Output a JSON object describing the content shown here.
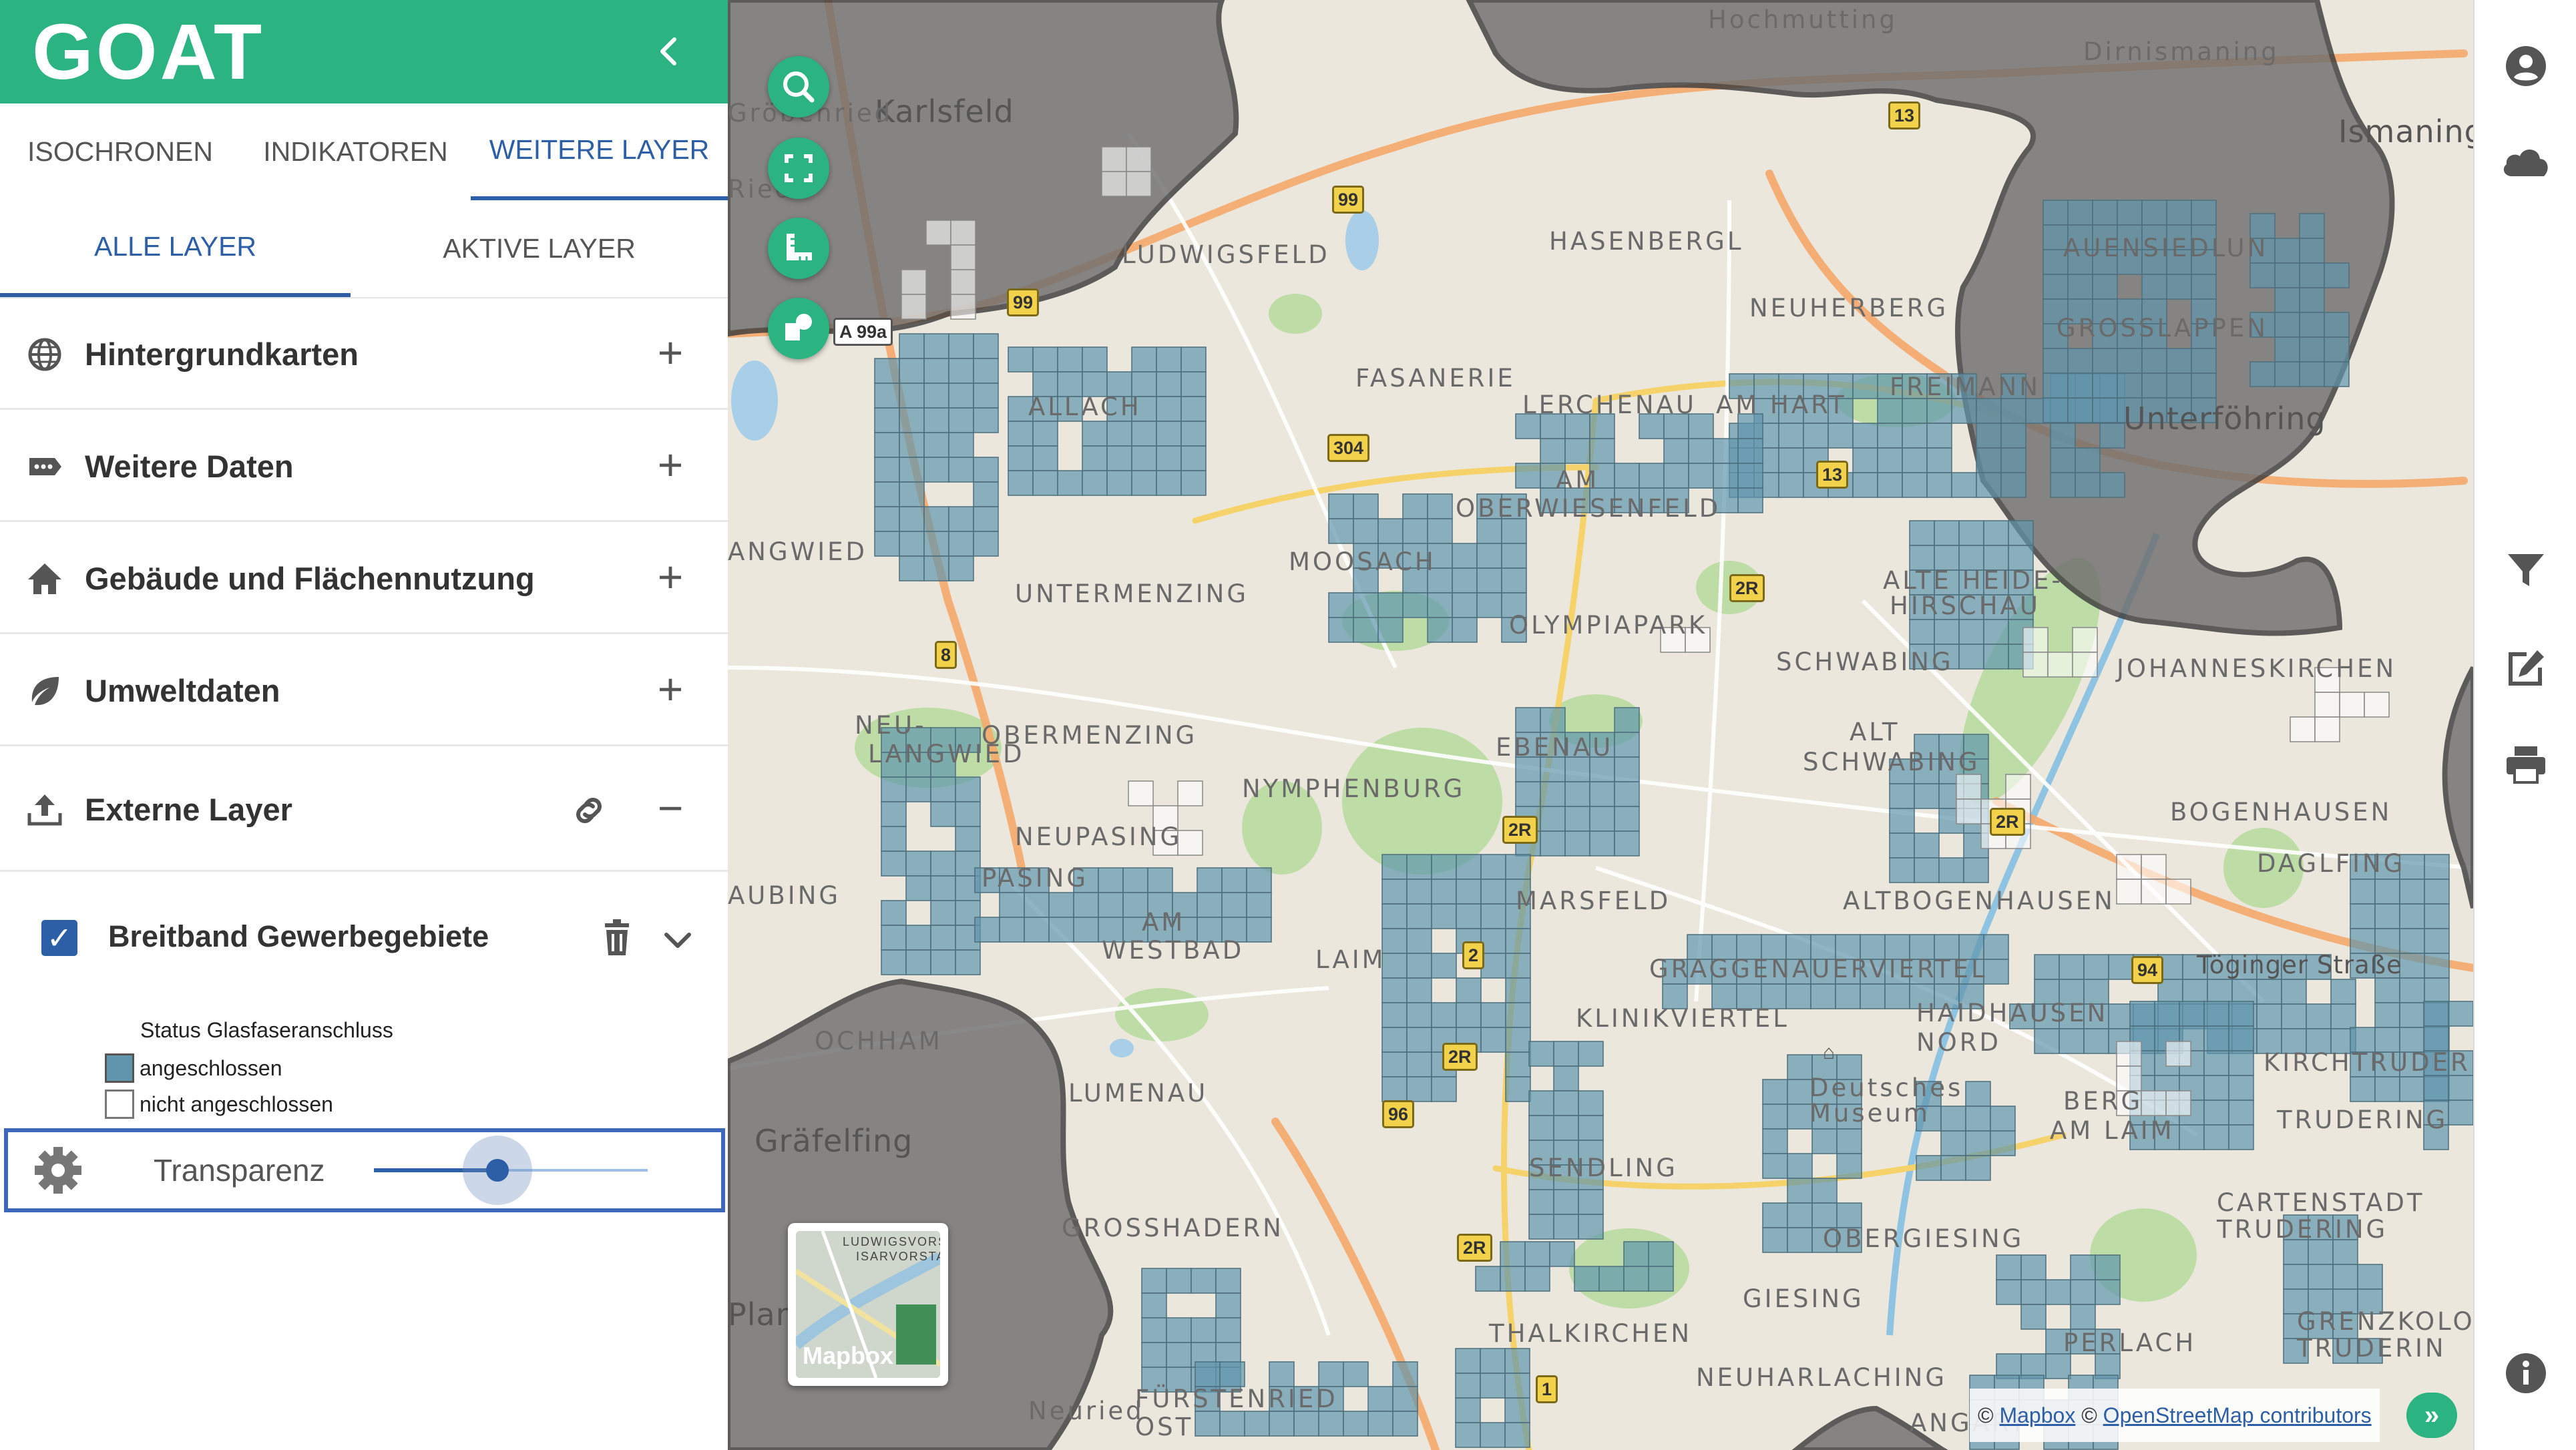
{
  "app": {
    "logo_text": "GOAT",
    "brand_color": "#2bb381",
    "accent_color": "#2d5fa7"
  },
  "main_tabs": [
    "ISOCHRONEN",
    "INDIKATOREN",
    "WEITERE LAYER"
  ],
  "sub_tabs": [
    "ALLE LAYER",
    "AKTIVE LAYER"
  ],
  "categories": [
    {
      "label": "Hintergrundkarten",
      "icon": "globe-icon"
    },
    {
      "label": "Weitere Daten",
      "icon": "data-tag-icon"
    },
    {
      "label": "Gebäude und Flächennutzung",
      "icon": "home-icon"
    },
    {
      "label": "Umweltdaten",
      "icon": "leaf-icon"
    },
    {
      "label": "Externe Layer",
      "icon": "upload-icon"
    }
  ],
  "active_layer": {
    "name": "Breitband Gewerbegebiete",
    "checked": true
  },
  "legend": {
    "title": "Status Glasfaseranschluss",
    "items": [
      {
        "label": "angeschlossen",
        "color": "#5f96ae"
      },
      {
        "label": "nicht angeschlossen",
        "color": "#ffffff"
      }
    ]
  },
  "transparency": {
    "label": "Transparenz",
    "value": 0.45
  },
  "map": {
    "basemap_label": "Mapbox",
    "basemap_thumb_text": [
      "LUDWIGSVORS",
      "ISARVORSTA"
    ],
    "attribution": {
      "mapbox": "Mapbox",
      "osm": "OpenStreetMap contributors"
    },
    "places": [
      "Karlsfeld",
      "Hochmutting",
      "Dirnismaning",
      "Ismaning",
      "LUDWIGSFELD",
      "HASENBERGL",
      "AUENSIEDLUN",
      "NEUHERBERG",
      "GROSSLAPPEN",
      "FASANERIE",
      "FREIMANN",
      "Unterföhring",
      "ALLACH",
      "LERCHENAU",
      "AM HART",
      "AM",
      "OBERWIESENFELD",
      "ANGWIED",
      "UNTERMENZING",
      "MOOSACH",
      "ALTE HEIDE-",
      "HIRSCHAU",
      "OLYMPIAPARK",
      "SCHWABING",
      "JOHANNESKIRCHEN",
      "NEU-",
      "LANGWIED",
      "OBERMENZING",
      "ALT",
      "SCHWABING",
      "EBENAU",
      "NYMPHENBURG",
      "BOGENHAUSEN",
      "NEUPASING",
      "PASING",
      "DAGLFING",
      "AUBING",
      "AM",
      "WESTBAD",
      "LAIM",
      "MARSFELD",
      "ALTBOGENHAUSEN",
      "GRAGGENAUERVIERTEL",
      "OCHHAM",
      "KLINIKVIERTEL",
      "HAIDHAUSEN",
      "NORD",
      "KIRCHTRUDERIN",
      "Deutsches",
      "Museum",
      "BERG",
      "AM LAIM",
      "TRUDERING",
      "Gräfelfing",
      "LUMENAU",
      "SENDLING",
      "CARTENSTADT",
      "TRUDERING",
      "GROSSHADERN",
      "OBERGIESING",
      "Plan",
      "GIESING",
      "PERLACH",
      "GRENZKOLO",
      "TRUDERIN",
      "THALKIRCHEN",
      "NEUHARLACHING",
      "FÜRSTENRIED",
      "OST",
      "Neuried",
      "ANGART",
      "Gröbenried",
      "Ried"
    ],
    "road_shields": [
      "99",
      "99",
      "A 99a",
      "304",
      "13",
      "13",
      "2R",
      "8",
      "2R",
      "2R",
      "2",
      "2R",
      "96",
      "2R",
      "94",
      "Töginger Straße",
      "1"
    ]
  }
}
